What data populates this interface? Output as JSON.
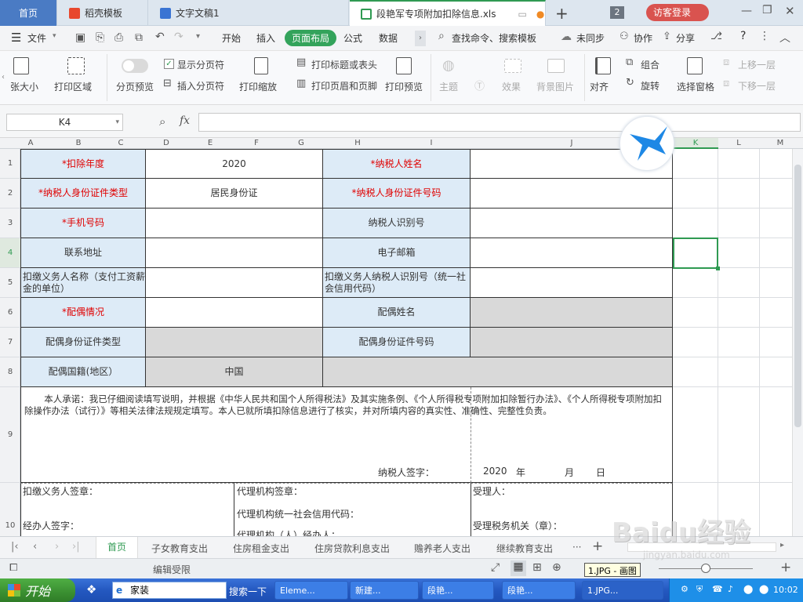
{
  "tabs": {
    "home": "首页",
    "t1": "稻壳模板",
    "t2": "文字文稿1",
    "t3": "段艳军专项附加扣除信息.xls",
    "num": "2",
    "login": "访客登录"
  },
  "menu": {
    "file": "文件",
    "start": "开始",
    "insert": "插入",
    "layout": "页面布局",
    "formula": "公式",
    "data": "数据",
    "search": "查找命令、搜索模板",
    "unsync": "未同步",
    "collab": "协作",
    "share": "分享",
    "help": "?"
  },
  "ribbon": {
    "paper": "张大小",
    "area": "打印区域",
    "pbpreview": "分页预览",
    "showpb": "显示分页符",
    "insertpb": "插入分页符",
    "scale": "打印缩放",
    "titles": "打印标题或表头",
    "hf": "打印页眉和页脚",
    "preview": "打印预览",
    "theme": "主题",
    "effect": "效果",
    "bg": "背景图片",
    "align": "对齐",
    "group": "组合",
    "rotate": "旋转",
    "selpane": "选择窗格",
    "up": "上移一层",
    "down": "下移一层"
  },
  "formula": {
    "cell": "K4",
    "fx": "fx"
  },
  "cols": [
    "A",
    "B",
    "C",
    "D",
    "E",
    "F",
    "G",
    "H",
    "I",
    "J",
    "K",
    "L",
    "M"
  ],
  "rows": [
    "1",
    "2",
    "3",
    "4",
    "5",
    "6",
    "7",
    "8",
    "9",
    "10"
  ],
  "cells": {
    "r1a": "*扣除年度",
    "r1d": "2020",
    "r1h": "*纳税人姓名",
    "r2a": "*纳税人身份证件类型",
    "r2d": "居民身份证",
    "r2h": "*纳税人身份证件号码",
    "r3a": "*手机号码",
    "r3h": "纳税人识别号",
    "r4a": "联系地址",
    "r4h": "电子邮箱",
    "r5a": "扣缴义务人名称（支付工资薪金的单位）",
    "r5h": "扣缴义务人纳税人识别号（统一社会信用代码）",
    "r6a": "*配偶情况",
    "r6h": "配偶姓名",
    "r7a": "配偶身份证件类型",
    "r7h": "配偶身份证件号码",
    "r8a": "配偶国籍(地区）",
    "r8d": "中国",
    "pledge": "本人承诺：我已仔细阅读填写说明，并根据《中华人民共和国个人所得税法》及其实施条例、《个人所得税专项附加扣除暂行办法》、《个人所得税专项附加扣除操作办法（试行）》等相关法律法规规定填写。本人已就所填扣除信息进行了核实，并对所填内容的真实性、准确性、完整性负责。",
    "sig": "纳税人签字：",
    "year": "2020",
    "nian": "年",
    "yue": "月",
    "ri": "日",
    "r10a1": "扣缴义务人签章：",
    "r10a2": "经办人签字：",
    "r10b1": "代理机构签章：",
    "r10b2": "代理机构统一社会信用代码：",
    "r10b3": "代理机构（人）经办人：",
    "r10c1": "受理人：",
    "r10c2": "受理税务机关（章）："
  },
  "sheets": [
    "首页",
    "子女教育支出",
    "住房租金支出",
    "住房贷款利息支出",
    "赡养老人支出",
    "继续教育支出",
    "···",
    "+"
  ],
  "status": {
    "edit": "编辑受限",
    "tooltip": "1.JPG - 画图"
  },
  "taskbar": {
    "start": "开始",
    "ie": "家装",
    "search": "搜索一下",
    "t1": "Eleme...",
    "t2": "新建...",
    "t3": "段艳...",
    "t4": "段艳...",
    "t5": "1.JPG...",
    "time": "10:02"
  },
  "watermark": "Baidu经验",
  "watermark_url": "jingyan.baidu.com"
}
